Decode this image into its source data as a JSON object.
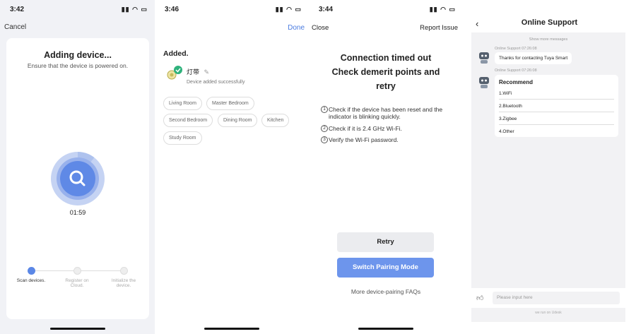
{
  "colors": {
    "accent": "#5b87e6",
    "button_primary": "#6d95ec",
    "done_link": "#4a7be0"
  },
  "screen1": {
    "time": "3:42",
    "cancel": "Cancel",
    "title": "Adding device...",
    "subtitle": "Ensure that the device is powered on.",
    "timer": "01:59",
    "steps": [
      {
        "label": "Scan devices.",
        "active": true,
        "icon": "dot-icon"
      },
      {
        "label": "Register on Cloud.",
        "active": false,
        "icon": "cloud-icon"
      },
      {
        "label": "Initialize the device.",
        "active": false,
        "icon": "power-icon"
      }
    ]
  },
  "screen2": {
    "time": "3:46",
    "done": "Done",
    "added": "Added.",
    "device_name": "灯带",
    "device_status": "Device added successfully",
    "rooms": [
      "Living Room",
      "Master Bedroom",
      "Second Bedroom",
      "Dining Room",
      "Kitchen",
      "Study Room"
    ]
  },
  "screen3": {
    "time": "3:44",
    "close": "Close",
    "report": "Report Issue",
    "headline_1": "Connection timed out",
    "headline_2": "Check demerit points and",
    "headline_3": "retry",
    "tips": [
      {
        "num": "1",
        "text": "Check if the device has been reset and the indicator is blinking quickly."
      },
      {
        "num": "2",
        "text": "Check if it is 2.4 GHz Wi-Fi."
      },
      {
        "num": "3",
        "text": "Verify the Wi-Fi password."
      }
    ],
    "retry": "Retry",
    "switch": "Switch Pairing Mode",
    "faq": "More device-pairing FAQs"
  },
  "screen4": {
    "title": "Online Support",
    "show_more": "Show more messages",
    "msg1_meta": "Online Support   07:26:08",
    "msg1_text": "Thanks for contacting Tuya Smart",
    "msg2_meta": "Online Support   07:26:08",
    "recommend_title": "Recommend",
    "recommend_items": [
      "1.WiFi",
      "2.Bluetooth",
      "3.Zigbee",
      "4.Other"
    ],
    "input_placeholder": "Please input here",
    "footer": "we run on Udesk"
  }
}
